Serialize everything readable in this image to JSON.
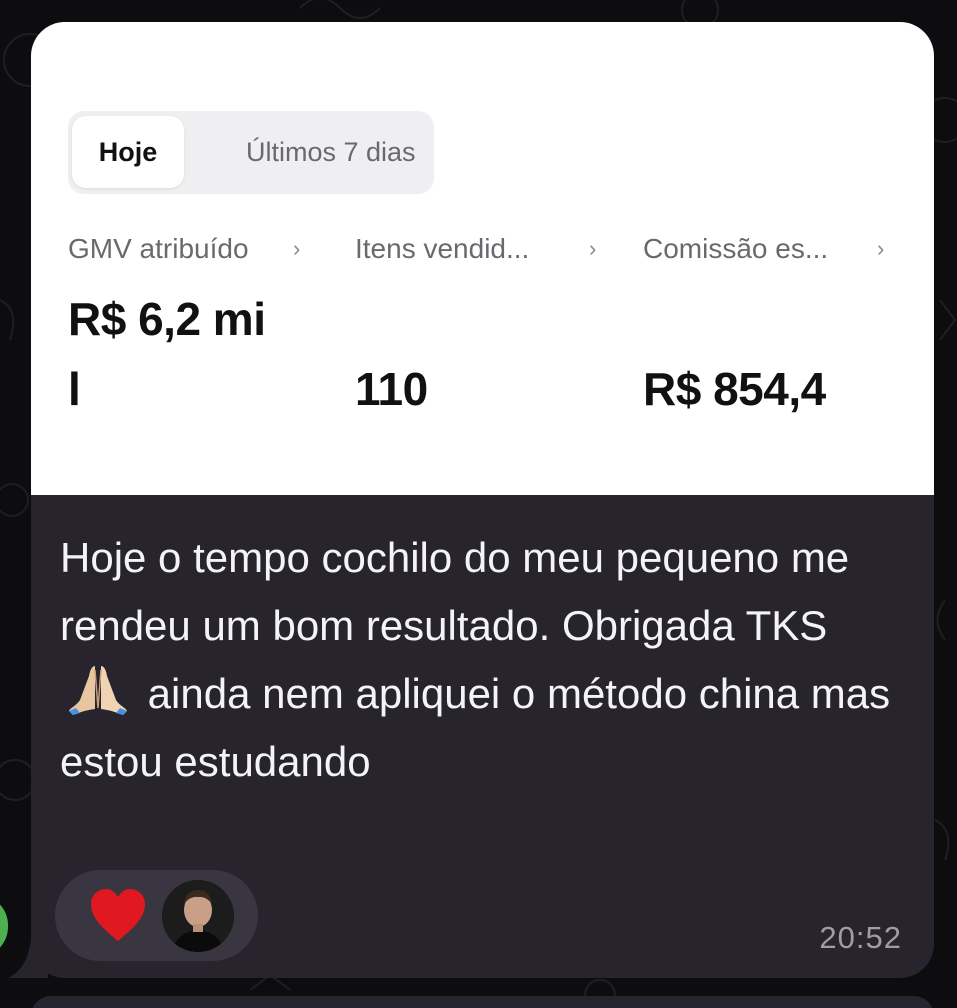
{
  "screenshot": {
    "tabs": {
      "active": "Hoje",
      "inactive": "Últimos 7 dias"
    },
    "metrics": [
      {
        "label": "GMV atribuído",
        "value_line1": "R$ 6,2 mi",
        "value_line2": "l"
      },
      {
        "label": "Itens vendid...",
        "value": "110"
      },
      {
        "label": "Comissão es...",
        "value": "R$ 854,4"
      }
    ],
    "chevron": "›"
  },
  "message": {
    "text_before_emoji": "Hoje o tempo cochilo do meu pequeno me rendeu um bom resultado. Obrigada TKS",
    "emoji": "folded-hands",
    "text_after_emoji": "ainda nem apliquei o método china mas estou estudando",
    "time": "20:52"
  },
  "reaction": {
    "emoji": "red-heart",
    "reactor": "avatar"
  },
  "colors": {
    "bubble": "#27242e",
    "background": "#0d0d10",
    "heart": "#e0181f"
  }
}
